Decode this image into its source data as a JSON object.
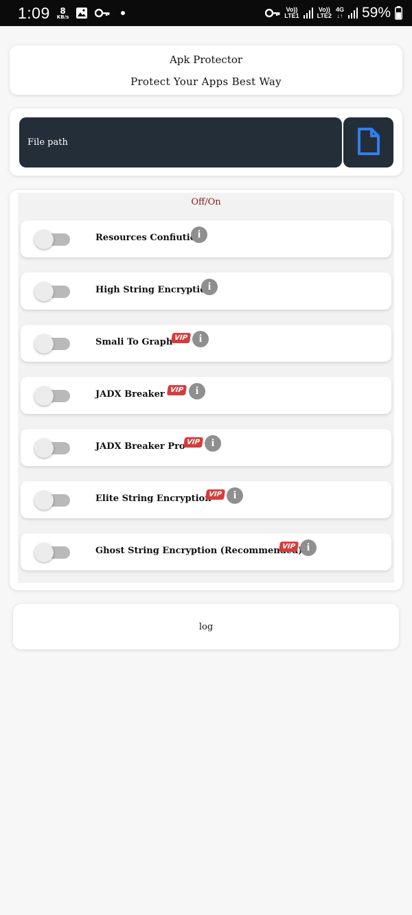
{
  "status_bar": {
    "time": "1:09",
    "speed_value": "8",
    "speed_unit": "KB/s",
    "sim1_top": "Vo))",
    "sim1_bottom": "LTE1",
    "sim2_top": "Vo))",
    "sim2_bottom": "LTE2",
    "network_type": "4G",
    "battery": "59%",
    "icons": [
      "gallery-icon",
      "key-icon",
      "dot-icon",
      "vpn-key-icon",
      "signal-icon",
      "battery-icon"
    ]
  },
  "header": {
    "title": "Apk Protector",
    "subtitle": "Protect Your Apps Best Way"
  },
  "file_picker": {
    "placeholder": "File path",
    "button_icon": "file-icon"
  },
  "options": {
    "heading": "Off/On",
    "vip_label": "VIP",
    "info_glyph": "i",
    "items": [
      {
        "label": "Resources Confiution",
        "vip": false,
        "enabled": false
      },
      {
        "label": "High String Encryption",
        "vip": false,
        "enabled": false
      },
      {
        "label": "Smali To Graph",
        "vip": true,
        "enabled": false
      },
      {
        "label": "JADX Breaker",
        "vip": true,
        "enabled": false
      },
      {
        "label": "JADX Breaker Pro",
        "vip": true,
        "enabled": false
      },
      {
        "label": "Elite String Encryption",
        "vip": true,
        "enabled": false
      },
      {
        "label": "Ghost String Encryption (Recommended)",
        "vip": true,
        "enabled": false
      }
    ]
  },
  "log": {
    "text": "log"
  },
  "colors": {
    "dark_field": "#242e38",
    "accent_blue": "#2f80ed",
    "vip_red": "#d63c3c",
    "heading_red": "#8b1e1e"
  }
}
